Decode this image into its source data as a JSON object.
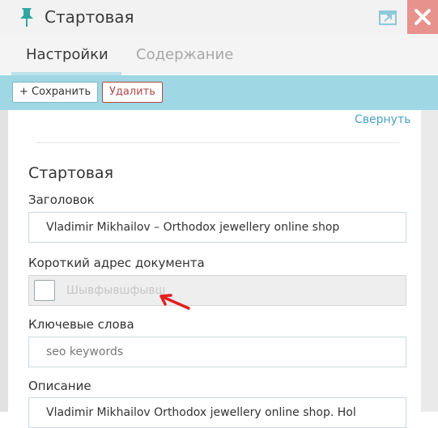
{
  "window": {
    "title": "Стартовая",
    "icons": [
      "pin-icon",
      "undock-icon",
      "close-icon"
    ],
    "close_color": "#e8928e"
  },
  "tabs": [
    {
      "label": "Настройки",
      "active": true
    },
    {
      "label": "Содержание",
      "active": false
    }
  ],
  "toolbar": {
    "save_label": "+ Сохранить",
    "delete_label": "Удалить",
    "background": "#9fd7e4"
  },
  "panel": {
    "collapse_label": "Свернуть",
    "section_title": "Стартовая"
  },
  "form": {
    "title_label": "Заголовок",
    "title_value": "Vladimir Mikhailov – Orthodox jewellery online shop",
    "alias_label": "Короткий адрес документа",
    "alias_value": "Шывфывшфывш",
    "alias_checked": false,
    "keywords_label": "Ключевые слова",
    "keywords_placeholder": "seo keywords",
    "description_label": "Описание",
    "description_value": "Vladimir Mikhailov Orthodox jewellery online shop. Hol"
  },
  "annotation": {
    "type": "red-arrow",
    "color": "#e02020"
  }
}
